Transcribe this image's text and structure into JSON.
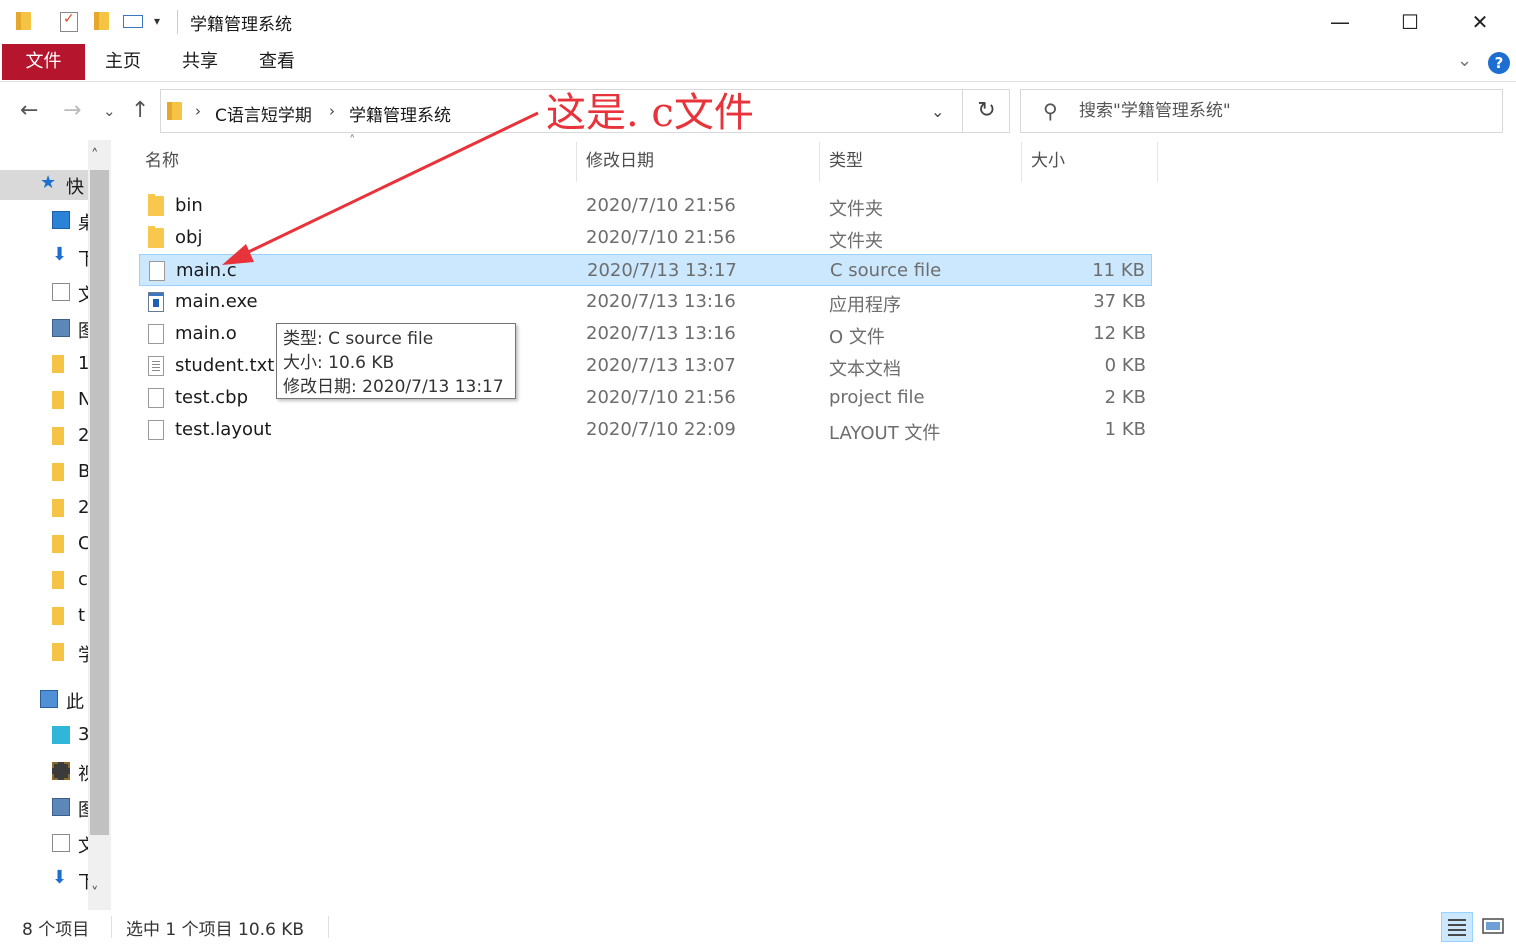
{
  "window": {
    "title": "学籍管理系统",
    "minimize_glyph": "—",
    "maximize_glyph": "☐",
    "close_glyph": "✕"
  },
  "ribbon": {
    "tabs": [
      "文件",
      "主页",
      "共享",
      "查看"
    ],
    "help_glyph": "?",
    "collapse_glyph": "⌄"
  },
  "nav": {
    "back_glyph": "←",
    "forward_glyph": "→",
    "recent_glyph": "⌄",
    "up_glyph": "↑"
  },
  "address": {
    "crumbs": [
      "C语言短学期",
      "学籍管理系统"
    ],
    "separator": "›",
    "dropdown_glyph": "⌄",
    "refresh_glyph": "↻"
  },
  "search": {
    "placeholder": "搜索\"学籍管理系统\"",
    "icon_glyph": "⚲"
  },
  "navpane": {
    "scroll_up": "˄",
    "scroll_down": "˅",
    "items": [
      {
        "label": "快",
        "icon": "star-icon"
      },
      {
        "label": "桌",
        "icon": "desktop-icon"
      },
      {
        "label": "下",
        "icon": "download-icon"
      },
      {
        "label": "文",
        "icon": "document-icon"
      },
      {
        "label": "图",
        "icon": "picture-icon"
      },
      {
        "label": "1",
        "icon": "folder-icon"
      },
      {
        "label": "N",
        "icon": "folder-icon"
      },
      {
        "label": "2",
        "icon": "folder-icon"
      },
      {
        "label": "B",
        "icon": "folder-icon"
      },
      {
        "label": "2",
        "icon": "folder-icon"
      },
      {
        "label": "C",
        "icon": "folder-icon"
      },
      {
        "label": "c",
        "icon": "folder-icon"
      },
      {
        "label": "t",
        "icon": "folder-icon"
      },
      {
        "label": "学",
        "icon": "folder-icon"
      },
      {
        "label": "此",
        "icon": "computer-icon"
      },
      {
        "label": "3",
        "icon": "cube-icon"
      },
      {
        "label": "视",
        "icon": "video-icon"
      },
      {
        "label": "图",
        "icon": "picture-icon"
      },
      {
        "label": "文",
        "icon": "document-icon"
      },
      {
        "label": "下",
        "icon": "download-icon"
      }
    ]
  },
  "columns": {
    "name": "名称",
    "date": "修改日期",
    "type": "类型",
    "size": "大小",
    "sort_glyph": "˄"
  },
  "files": [
    {
      "name": "bin",
      "date": "2020/7/10 21:56",
      "type": "文件夹",
      "size": "",
      "icon": "folder-icon",
      "selected": false
    },
    {
      "name": "obj",
      "date": "2020/7/10 21:56",
      "type": "文件夹",
      "size": "",
      "icon": "folder-icon",
      "selected": false
    },
    {
      "name": "main.c",
      "date": "2020/7/13 13:17",
      "type": "C source file",
      "size": "11 KB",
      "icon": "file-icon",
      "selected": true
    },
    {
      "name": "main.exe",
      "date": "2020/7/13 13:16",
      "type": "应用程序",
      "size": "37 KB",
      "icon": "exe-icon",
      "selected": false
    },
    {
      "name": "main.o",
      "date": "2020/7/13 13:16",
      "type": "O 文件",
      "size": "12 KB",
      "icon": "file-icon",
      "selected": false
    },
    {
      "name": "student.txt",
      "date": "2020/7/13 13:07",
      "type": "文本文档",
      "size": "0 KB",
      "icon": "text-file-icon",
      "selected": false
    },
    {
      "name": "test.cbp",
      "date": "2020/7/10 21:56",
      "type": "project file",
      "size": "2 KB",
      "icon": "file-icon",
      "selected": false
    },
    {
      "name": "test.layout",
      "date": "2020/7/10 22:09",
      "type": "LAYOUT 文件",
      "size": "1 KB",
      "icon": "file-icon",
      "selected": false
    }
  ],
  "tooltip": {
    "type_line": "类型: C source file",
    "size_line": "大小: 10.6 KB",
    "date_line": "修改日期: 2020/7/13 13:17"
  },
  "annotation": {
    "text": "这是. c文件",
    "color": "#e8333a"
  },
  "status": {
    "item_count": "8 个项目",
    "selection": "选中 1 个项目  10.6 KB"
  },
  "colors": {
    "file_tab": "#b5152d",
    "selection_bg": "#cce8ff",
    "selection_border": "#99d1ff",
    "help_blue": "#1c6fd1"
  }
}
